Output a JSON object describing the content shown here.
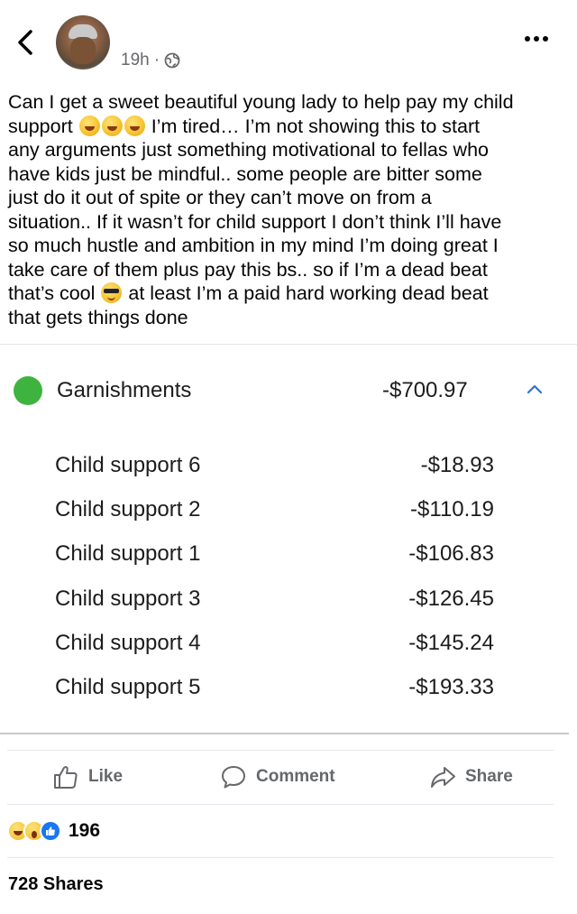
{
  "post": {
    "timestamp": "19h",
    "visibility_icon": "globe-icon",
    "lines": [
      "Can I get a sweet beautiful young lady to help pay my child",
      "I’m tired… I’m not showing this to start",
      "any arguments just something motivational to fellas who",
      "have kids just be mindful.. some people are bitter some",
      "just do it out of spite or they can’t move on from a",
      "situation.. If it wasn’t for child support I don’t think I’ll have",
      "so much hustle and ambition in my mind I’m doing great I",
      "take care of them plus pay this bs.. so if I’m a dead beat",
      "at least I’m a paid hard working dead beat",
      "that gets things done"
    ],
    "line2_prefix": "support",
    "line9_prefix": "that’s cool"
  },
  "garnishments": {
    "label": "Garnishments",
    "amount": "-$700.97",
    "dot_color": "#3fb33f",
    "items": [
      {
        "label": "Child support 6",
        "amount": "-$18.93"
      },
      {
        "label": "Child support 2",
        "amount": "-$110.19"
      },
      {
        "label": "Child support 1",
        "amount": "-$106.83"
      },
      {
        "label": "Child support 3",
        "amount": "-$126.45"
      },
      {
        "label": "Child support 4",
        "amount": "-$145.24"
      },
      {
        "label": "Child support 5",
        "amount": "-$193.33"
      }
    ]
  },
  "actions": {
    "like": "Like",
    "comment": "Comment",
    "share": "Share"
  },
  "reactions": {
    "icons": [
      "haha-reaction-icon",
      "wow-reaction-icon",
      "like-reaction-icon"
    ],
    "count": "196"
  },
  "shares": "728 Shares"
}
